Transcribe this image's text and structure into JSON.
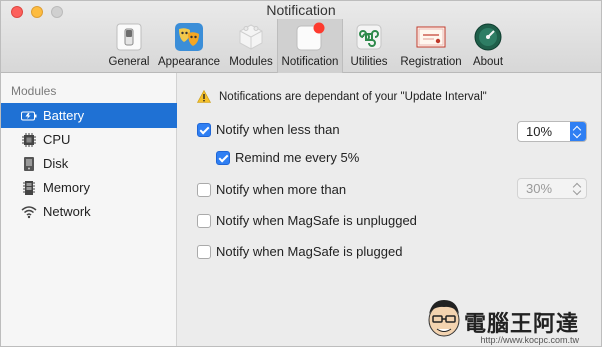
{
  "window": {
    "title": "Notification"
  },
  "toolbar": {
    "tabs": [
      {
        "label": "General",
        "icon": "switch-icon"
      },
      {
        "label": "Appearance",
        "icon": "theater-masks-icon"
      },
      {
        "label": "Modules",
        "icon": "modules-cube-icon"
      },
      {
        "label": "Notification",
        "icon": "notification-badge-icon",
        "active": true
      },
      {
        "label": "Utilities",
        "icon": "command-key-icon"
      },
      {
        "label": "Registration",
        "icon": "license-certificate-icon"
      },
      {
        "label": "About",
        "icon": "gauge-icon"
      }
    ]
  },
  "sidebar": {
    "heading": "Modules",
    "items": [
      {
        "label": "Battery",
        "icon": "battery-icon",
        "selected": true
      },
      {
        "label": "CPU",
        "icon": "cpu-chip-icon"
      },
      {
        "label": "Disk",
        "icon": "disk-icon"
      },
      {
        "label": "Memory",
        "icon": "memory-icon"
      },
      {
        "label": "Network",
        "icon": "wifi-icon"
      }
    ]
  },
  "main": {
    "warning": "Notifications are dependant of your \"Update Interval\"",
    "options": [
      {
        "label": "Notify when less than",
        "checked": true,
        "value": "10%",
        "enabled": true
      },
      {
        "label": "Remind me every 5%",
        "checked": true
      },
      {
        "label": "Notify when more than",
        "checked": false,
        "value": "30%",
        "enabled": false
      },
      {
        "label": "Notify when MagSafe is unplugged",
        "checked": false
      },
      {
        "label": "Notify when MagSafe is plugged",
        "checked": false
      }
    ]
  },
  "watermark": {
    "text": "電腦王阿達",
    "url": "http://www.kocpc.com.tw"
  },
  "colors": {
    "selection": "#1f71d4",
    "accent": "#2f7ff3",
    "badge": "#fd3b2f"
  }
}
